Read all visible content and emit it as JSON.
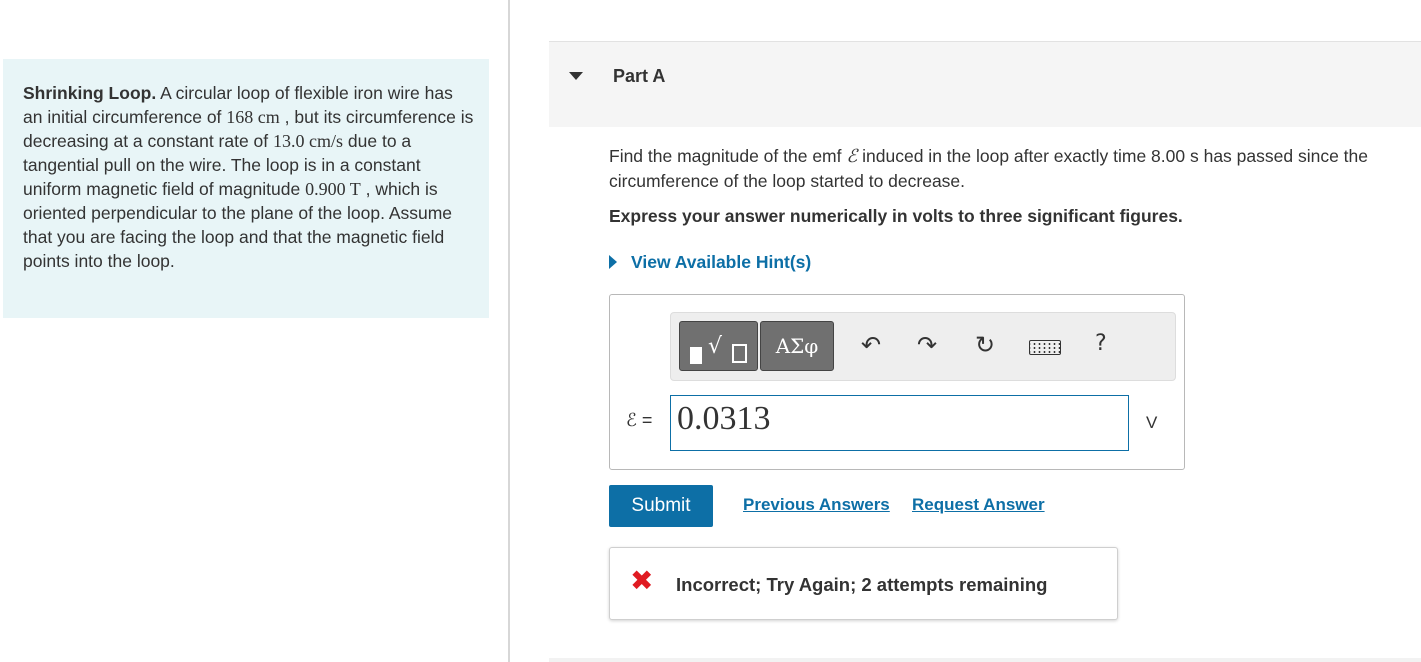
{
  "problem": {
    "title": "Shrinking Loop.",
    "segments": [
      {
        "text": " A circular loop of flexible iron wire has an initial circumference of ",
        "math": false
      },
      {
        "text": "168 cm",
        "math": true
      },
      {
        "text": " , but its circumference is decreasing at a constant rate of ",
        "math": false
      },
      {
        "text": "13.0 cm/s",
        "math": true
      },
      {
        "text": " due to a tangential pull on the wire. The loop is in a constant uniform magnetic field of magnitude ",
        "math": false
      },
      {
        "text": "0.900 T",
        "math": true
      },
      {
        "text": " , which is oriented perpendicular to the plane of the loop. Assume that you are facing the loop and that the magnetic field points into the loop.",
        "math": false
      }
    ]
  },
  "part": {
    "title": "Part A",
    "question_before": "Find the magnitude of the emf ",
    "emf_symbol": "ℰ",
    "question_after": " induced in the loop after exactly time 8.00 s has passed since the circumference of the loop started to decrease.",
    "instruction": "Express your answer numerically in volts to three significant figures.",
    "hint_label": "View Available Hint(s)"
  },
  "answer": {
    "toolbar": {
      "symbols_label": "ΑΣφ",
      "undo_icon": "undo-icon",
      "redo_icon": "redo-icon",
      "reset_icon": "reset-icon",
      "keyboard_icon": "keyboard-icon",
      "help_label": "?"
    },
    "label": "ℰ =",
    "value": "0.0313",
    "unit": "V"
  },
  "actions": {
    "submit_label": "Submit",
    "previous_answers_label": "Previous Answers",
    "request_answer_label": "Request Answer"
  },
  "feedback": {
    "text": "Incorrect; Try Again; 2 attempts remaining"
  },
  "colors": {
    "accent": "#0d6fa6",
    "error": "#e01b22",
    "panel_bg": "#e8f5f7"
  }
}
